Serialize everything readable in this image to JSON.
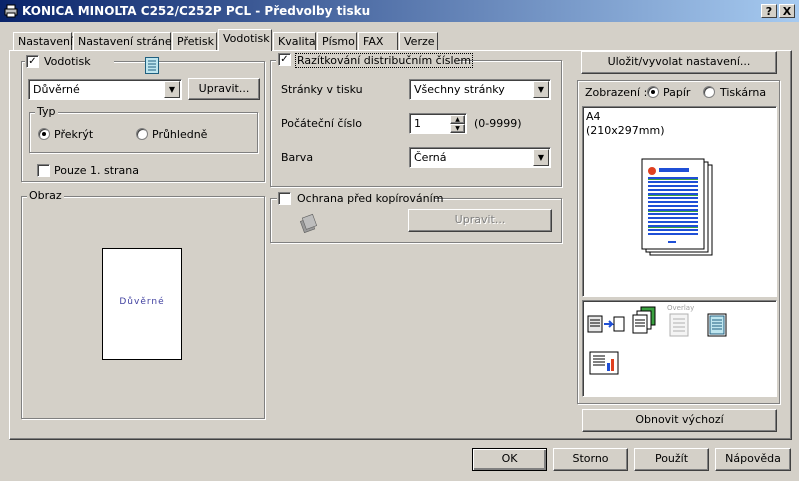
{
  "window": {
    "title": "KONICA MINOLTA C252/C252P PCL - Předvolby tisku",
    "help_button": "?",
    "close_button": "X"
  },
  "tabs": [
    {
      "label": "Nastavení"
    },
    {
      "label": "Nastavení stránek"
    },
    {
      "label": "Přetisk"
    },
    {
      "label": "Vodotisk"
    },
    {
      "label": "Kvalita"
    },
    {
      "label": "Písmo"
    },
    {
      "label": "FAX"
    },
    {
      "label": "Verze"
    }
  ],
  "active_tab": "Vodotisk",
  "watermark": {
    "checkbox_label": "Vodotisk",
    "checked": true,
    "selected": "Důvěrné",
    "edit_button": "Upravit...",
    "type_group": "Typ",
    "type_options": [
      {
        "label": "Překrýt",
        "selected": true
      },
      {
        "label": "Průhledně",
        "selected": false
      }
    ],
    "first_page_only_label": "Pouze 1. strana",
    "first_page_only_checked": false
  },
  "image_group": {
    "label": "Obraz",
    "preview_text": "Důvěrné"
  },
  "stamp": {
    "checkbox_label": "Razítkování distribučním číslem",
    "checked": true,
    "pages_label": "Stránky v tisku",
    "pages_value": "Všechny stránky",
    "start_label": "Počáteční číslo",
    "start_value": "1",
    "start_range": "(0-9999)",
    "color_label": "Barva",
    "color_value": "Černá"
  },
  "copy_protect": {
    "checkbox_label": "Ochrana před kopírováním",
    "checked": false,
    "edit_button": "Upravit..."
  },
  "right_panel": {
    "save_button": "Uložit/vyvolat nastavení...",
    "view_label": "Zobrazení :",
    "view_options": [
      {
        "label": "Papír",
        "selected": true
      },
      {
        "label": "Tiskárna",
        "selected": false
      }
    ],
    "paper_size": "A4",
    "paper_dims": "(210x297mm)",
    "overlay_label": "Overlay",
    "restore_button": "Obnovit výchozí"
  },
  "footer": {
    "ok": "OK",
    "cancel": "Storno",
    "apply": "Použít",
    "help": "Nápověda"
  },
  "colors": {
    "title_start": "#0a246a",
    "title_end": "#a6caf0",
    "face": "#d4d0c8",
    "preview_blue": "#1f4fd6"
  }
}
